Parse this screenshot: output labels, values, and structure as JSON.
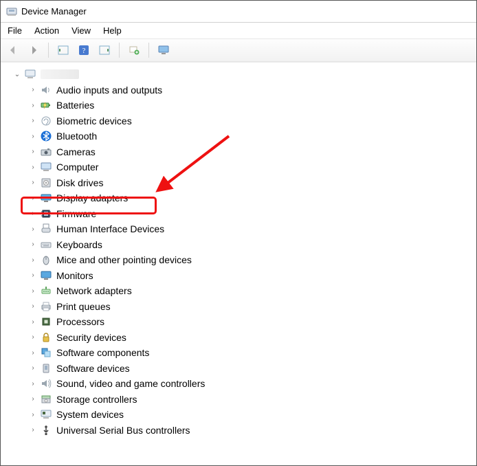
{
  "window": {
    "title": "Device Manager"
  },
  "menu": {
    "file": "File",
    "action": "Action",
    "view": "View",
    "help": "Help"
  },
  "root": {
    "expanded": true,
    "name_hidden": true
  },
  "categories": [
    {
      "key": "audio",
      "label": "Audio inputs and outputs",
      "icon": "speaker"
    },
    {
      "key": "batteries",
      "label": "Batteries",
      "icon": "battery"
    },
    {
      "key": "biometric",
      "label": "Biometric devices",
      "icon": "fingerprint"
    },
    {
      "key": "bluetooth",
      "label": "Bluetooth",
      "icon": "bluetooth"
    },
    {
      "key": "cameras",
      "label": "Cameras",
      "icon": "camera"
    },
    {
      "key": "computer",
      "label": "Computer",
      "icon": "computer"
    },
    {
      "key": "disk",
      "label": "Disk drives",
      "icon": "disk"
    },
    {
      "key": "display",
      "label": "Display adapters",
      "icon": "display",
      "highlighted": true
    },
    {
      "key": "firmware",
      "label": "Firmware",
      "icon": "chip"
    },
    {
      "key": "hid",
      "label": "Human Interface Devices",
      "icon": "hid"
    },
    {
      "key": "keyboards",
      "label": "Keyboards",
      "icon": "keyboard"
    },
    {
      "key": "mice",
      "label": "Mice and other pointing devices",
      "icon": "mouse"
    },
    {
      "key": "monitors",
      "label": "Monitors",
      "icon": "monitor"
    },
    {
      "key": "network",
      "label": "Network adapters",
      "icon": "network"
    },
    {
      "key": "print",
      "label": "Print queues",
      "icon": "printer"
    },
    {
      "key": "proc",
      "label": "Processors",
      "icon": "cpu"
    },
    {
      "key": "security",
      "label": "Security devices",
      "icon": "security"
    },
    {
      "key": "swcomp",
      "label": "Software components",
      "icon": "swcomponent"
    },
    {
      "key": "swdev",
      "label": "Software devices",
      "icon": "swdevice"
    },
    {
      "key": "sound",
      "label": "Sound, video and game controllers",
      "icon": "sound"
    },
    {
      "key": "storage",
      "label": "Storage controllers",
      "icon": "storage"
    },
    {
      "key": "system",
      "label": "System devices",
      "icon": "system"
    },
    {
      "key": "usb",
      "label": "Universal Serial Bus controllers",
      "icon": "usb"
    }
  ],
  "annotation": {
    "arrow_color": "#e11",
    "box_color": "#e11"
  }
}
